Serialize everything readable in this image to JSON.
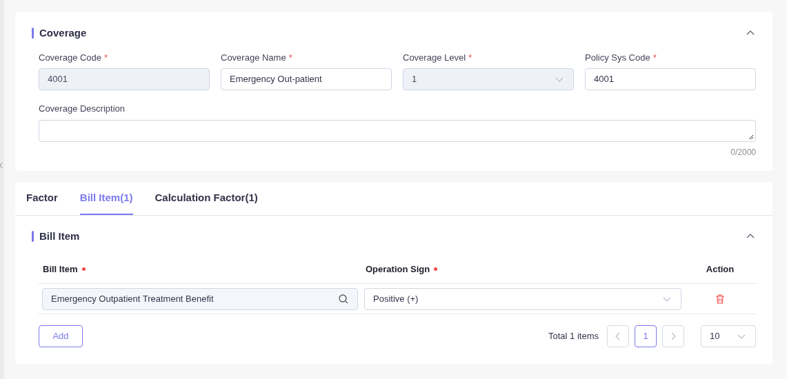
{
  "coverage": {
    "title": "Coverage",
    "expanded": true,
    "fields": [
      {
        "kind": "input",
        "label": "Coverage Code",
        "required_mark": "*",
        "value": "4001",
        "disabled": true
      },
      {
        "kind": "input",
        "label": "Coverage Name",
        "required_mark": "*",
        "value": "Emergency Out-patient",
        "disabled": false
      },
      {
        "kind": "select",
        "label": "Coverage Level",
        "required_mark": "*",
        "value": "1",
        "disabled": true
      },
      {
        "kind": "input",
        "label": "Policy Sys Code",
        "required_mark": "*",
        "value": "4001",
        "disabled": false
      }
    ],
    "description": {
      "label": "Coverage Description",
      "counter": "0/2000"
    }
  },
  "tabs": [
    {
      "label": "Factor",
      "selected": false
    },
    {
      "label": "Bill Item(1)",
      "selected": true
    },
    {
      "label": "Calculation Factor(1)",
      "selected": false
    }
  ],
  "bill_item": {
    "title": "Bill Item",
    "expanded": true,
    "columns": [
      {
        "label": "Bill Item",
        "required": true
      },
      {
        "label": "Operation Sign",
        "required": true
      },
      {
        "label": "Action",
        "required": false
      }
    ],
    "rows": [
      {
        "bill_item": "Emergency Outpatient Treatment Benefit",
        "operation_sign": "Positive (+)"
      }
    ],
    "add_button": "Add",
    "pagination": {
      "total": "Total 1 items",
      "pages": [
        {
          "label": "1",
          "selected": true
        }
      ],
      "page_size": "10"
    }
  }
}
